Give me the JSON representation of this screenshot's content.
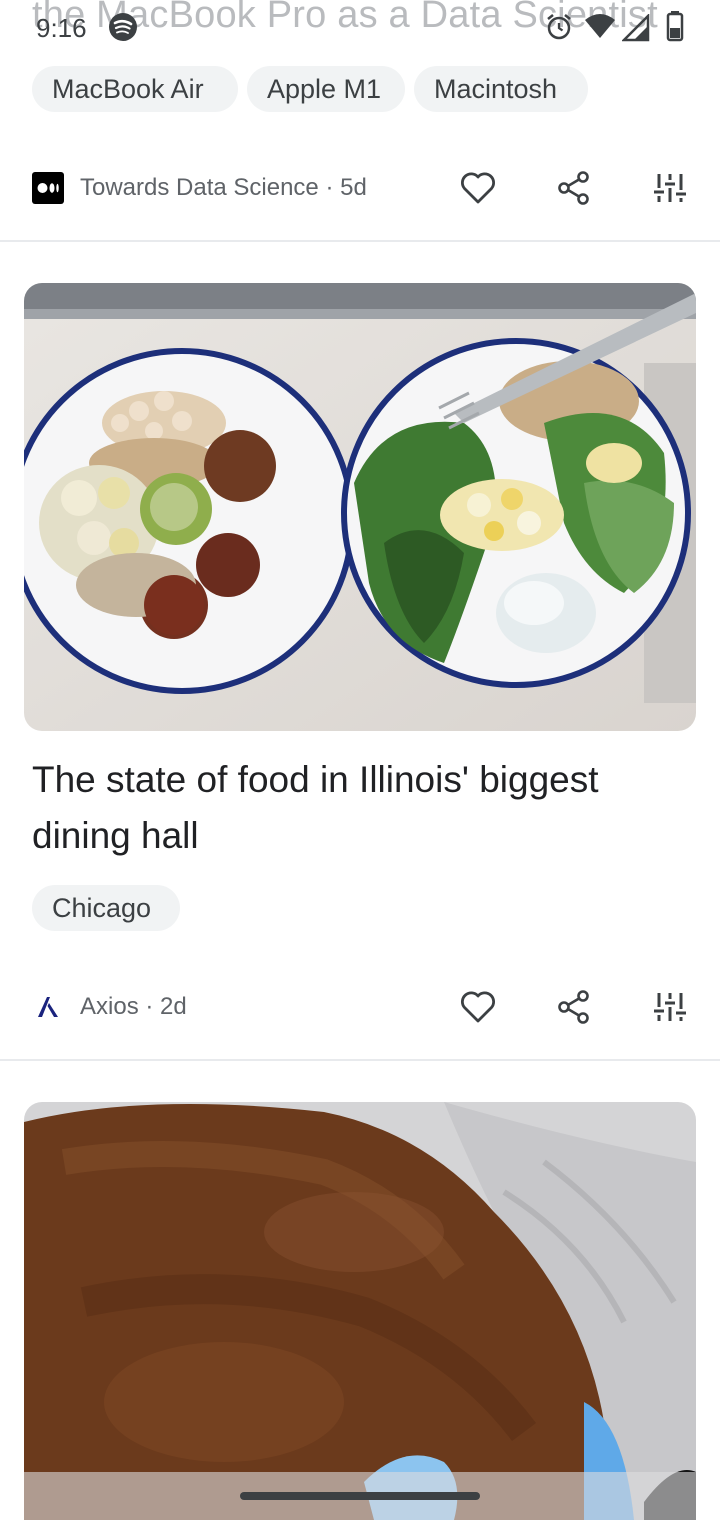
{
  "status_bar": {
    "time": "9:16",
    "icons": [
      "spotify-icon",
      "alarm-icon",
      "wifi-icon",
      "signal-icon",
      "battery-icon"
    ]
  },
  "previous_card": {
    "faded_title": "the MacBook Pro as a Data Scientist",
    "chips": [
      "MacBook Air",
      "Apple M1",
      "Macintosh"
    ],
    "source": "Towards Data Science · 5d"
  },
  "story_card": {
    "headline": "The state of food in Illinois' biggest dining hall",
    "chip": "Chicago",
    "source": "Axios · 2d"
  },
  "colors": {
    "chip_bg": "#f1f3f4",
    "text_primary": "#202124",
    "text_secondary": "#5f6368",
    "divider": "#e8eaed",
    "plate_rim": "#1d2f7a"
  }
}
